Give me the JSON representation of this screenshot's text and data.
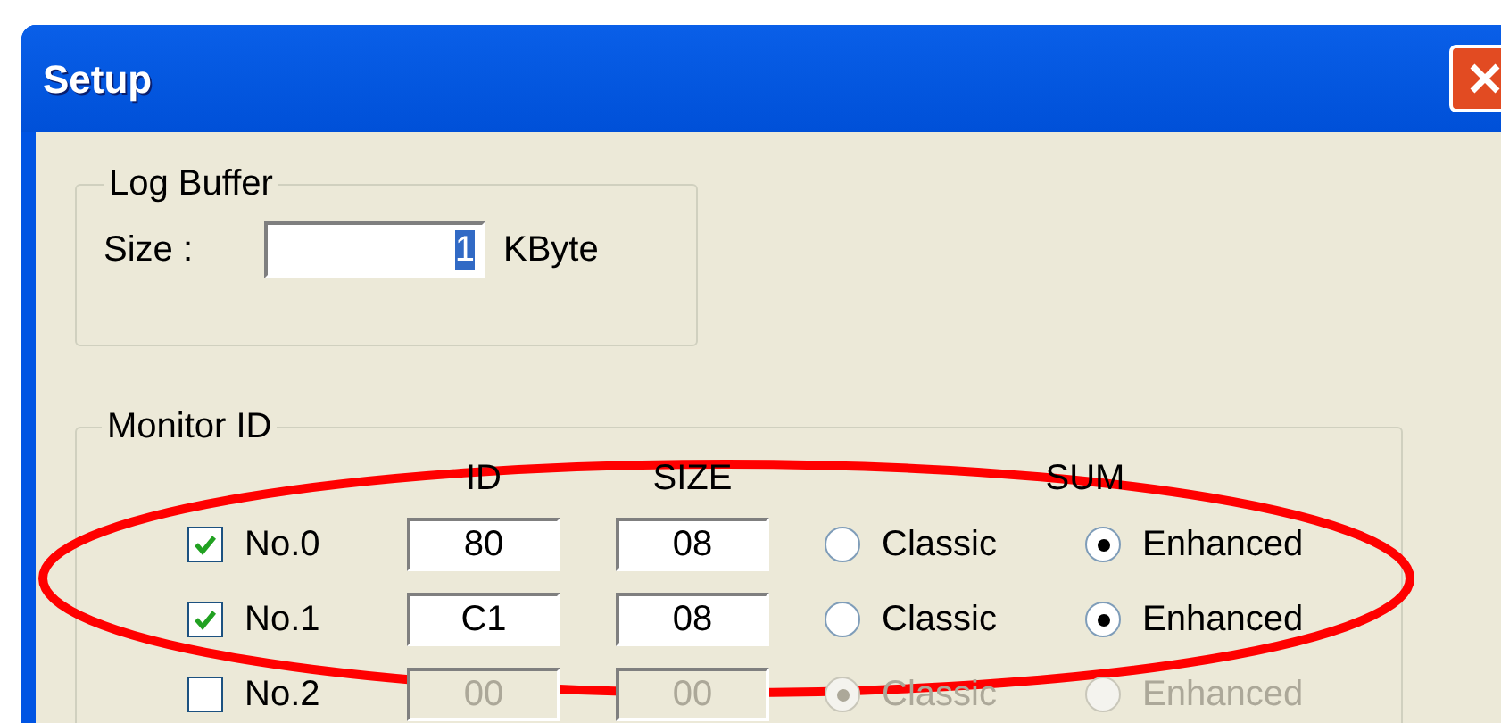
{
  "window": {
    "title": "Setup"
  },
  "log_buffer": {
    "title": "Log Buffer",
    "size_label": "Size :",
    "size_value": "1",
    "value_selected": true,
    "unit": "KByte"
  },
  "monitor_id": {
    "title": "Monitor ID",
    "columns": [
      "ID",
      "SIZE",
      "SUM"
    ],
    "rows": [
      {
        "label": "No.0",
        "checked": true,
        "disabled": false,
        "id": "80",
        "size": "08",
        "options": [
          {
            "label": "Classic",
            "selected": false
          },
          {
            "label": "Enhanced",
            "selected": true
          }
        ]
      },
      {
        "label": "No.1",
        "checked": true,
        "disabled": false,
        "id": "C1",
        "size": "08",
        "options": [
          {
            "label": "Classic",
            "selected": false
          },
          {
            "label": "Enhanced",
            "selected": true
          }
        ]
      },
      {
        "label": "No.2",
        "checked": false,
        "disabled": true,
        "id": "00",
        "size": "00",
        "options": [
          {
            "label": "Classic",
            "selected": true
          },
          {
            "label": "Enhanced",
            "selected": false
          }
        ]
      }
    ]
  },
  "annotation": {
    "kind": "ellipse"
  }
}
